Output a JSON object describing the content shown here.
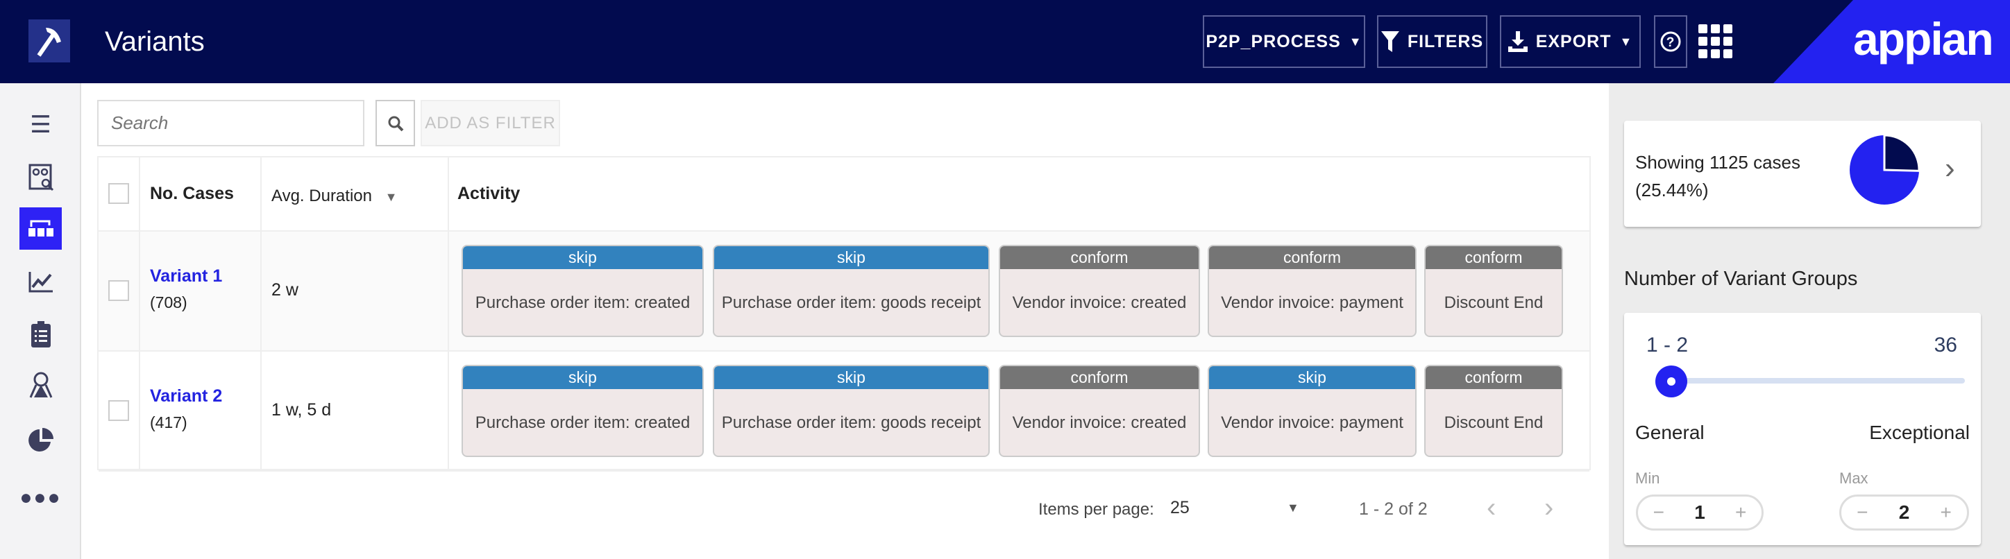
{
  "header": {
    "title": "Variants",
    "process_label": "P2P_PROCESS",
    "filters_label": "FILTERS",
    "export_label": "EXPORT",
    "brand": "appian"
  },
  "colors": {
    "header_bg": "#020b4f",
    "brand_blue": "#2322f0",
    "skip": "#3282be",
    "conform": "#757575",
    "link": "#2323e0"
  },
  "sidebar": {
    "items": [
      {
        "icon": "list-icon"
      },
      {
        "icon": "process-search-icon"
      },
      {
        "icon": "variants-icon",
        "active": true
      },
      {
        "icon": "chart-line-icon"
      },
      {
        "icon": "clipboard-icon"
      },
      {
        "icon": "risk-icon"
      },
      {
        "icon": "pie-chart-icon"
      },
      {
        "icon": "more-icon"
      }
    ]
  },
  "toolbar": {
    "search_placeholder": "Search",
    "add_filter_label": "ADD AS FILTER"
  },
  "table": {
    "columns": [
      "No. Cases",
      "Avg. Duration",
      "Activity"
    ],
    "rows": [
      {
        "name": "Variant 1",
        "count": "(708)",
        "duration": "2 w",
        "activities": [
          {
            "tag": "skip",
            "label": "Purchase order item: created"
          },
          {
            "tag": "skip",
            "label": "Purchase order item: goods receipt"
          },
          {
            "tag": "conform",
            "label": "Vendor invoice: created"
          },
          {
            "tag": "conform",
            "label": "Vendor invoice: payment"
          },
          {
            "tag": "conform",
            "label": "Discount End"
          }
        ]
      },
      {
        "name": "Variant 2",
        "count": "(417)",
        "duration": "1 w, 5 d",
        "activities": [
          {
            "tag": "skip",
            "label": "Purchase order item: created"
          },
          {
            "tag": "skip",
            "label": "Purchase order item: goods receipt"
          },
          {
            "tag": "conform",
            "label": "Vendor invoice: created"
          },
          {
            "tag": "skip",
            "label": "Vendor invoice: payment"
          },
          {
            "tag": "conform",
            "label": "Discount End"
          }
        ]
      }
    ]
  },
  "pagination": {
    "items_per_page_label": "Items per page:",
    "items_per_page": "25",
    "range": "1 - 2 of 2"
  },
  "summary": {
    "line1": "Showing 1125 cases",
    "line2": "(25.44%)",
    "percent": 25.44
  },
  "groups": {
    "title": "Number of Variant Groups",
    "range": "1 - 2",
    "max": "36",
    "slider_value": 1,
    "left_label": "General",
    "right_label": "Exceptional",
    "min_label": "Min",
    "max_label": "Max",
    "min_value": "1",
    "max_value": "2"
  }
}
